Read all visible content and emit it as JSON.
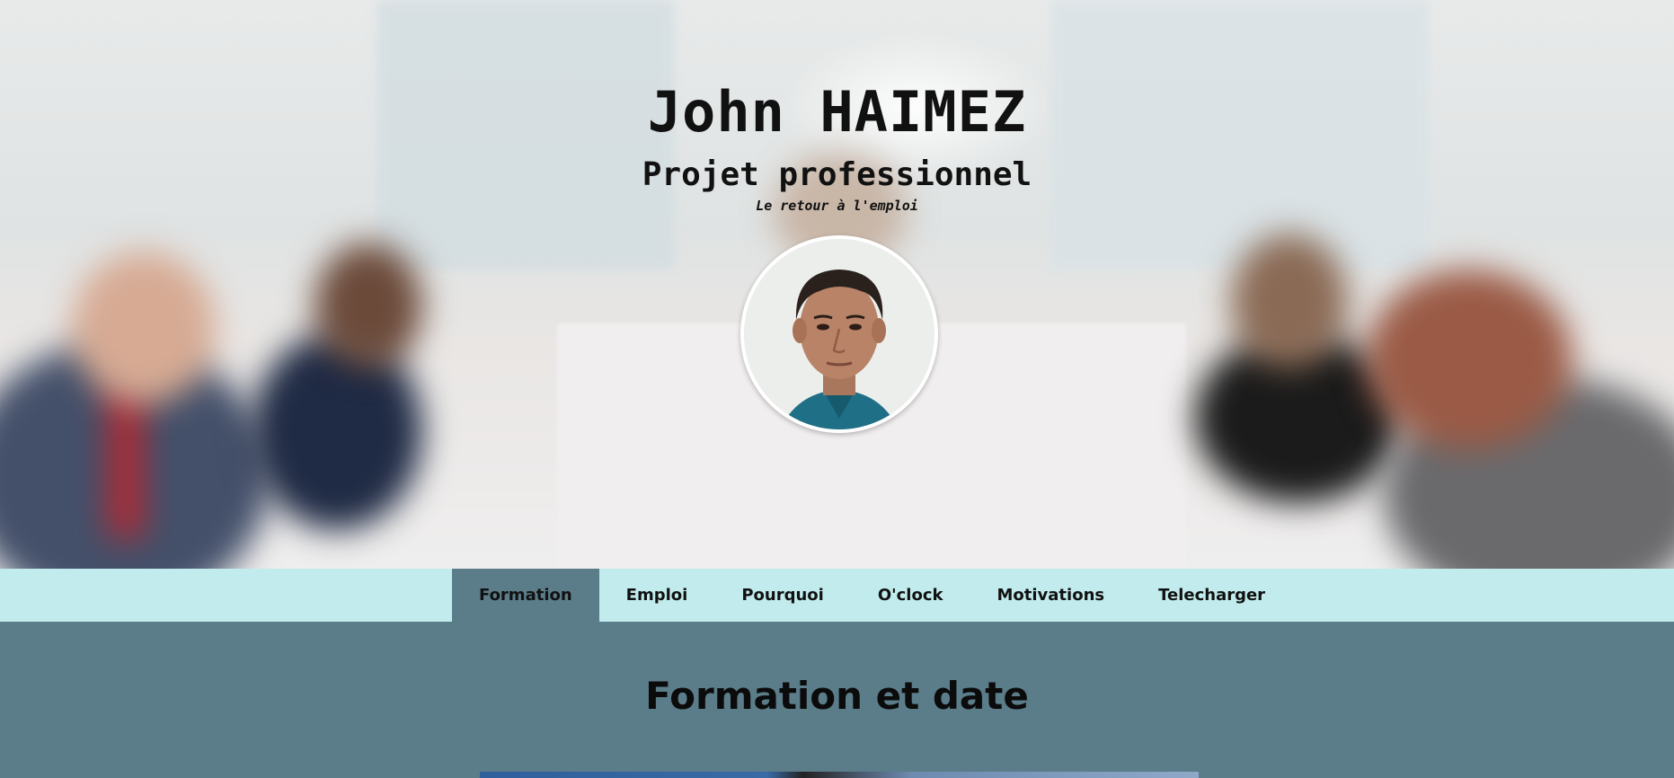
{
  "hero": {
    "name": "John HAIMEZ",
    "subtitle": "Projet professionnel",
    "tagline": "Le retour à l'emploi",
    "avatar_alt": "Portrait"
  },
  "nav": {
    "items": [
      {
        "label": "Formation",
        "active": true
      },
      {
        "label": "Emploi",
        "active": false
      },
      {
        "label": "Pourquoi",
        "active": false
      },
      {
        "label": "O'clock",
        "active": false
      },
      {
        "label": "Motivations",
        "active": false
      },
      {
        "label": "Telecharger",
        "active": false
      }
    ]
  },
  "section": {
    "title": "Formation et date"
  },
  "colors": {
    "nav_bg": "#c1ebed",
    "content_bg": "#5b7c89",
    "active_tab": "#5b7c89"
  }
}
